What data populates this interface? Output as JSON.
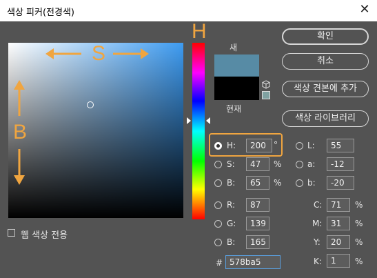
{
  "window": {
    "title": "색상 피커(전경색)",
    "close_icon": "✕"
  },
  "overlay": {
    "s_letter": "S",
    "b_letter": "B",
    "h_letter": "H",
    "accent": "#f0a540"
  },
  "swatches": {
    "new_label": "새",
    "current_label": "현재",
    "new_color": "#578ba5",
    "current_color": "#000000"
  },
  "buttons": {
    "ok": "확인",
    "cancel": "취소",
    "add_to_swatches": "색상 견본에 추가",
    "color_libraries": "색상 라이브러리"
  },
  "hsb": {
    "h": {
      "label": "H:",
      "value": "200",
      "unit": "°",
      "selected": true
    },
    "s": {
      "label": "S:",
      "value": "47",
      "unit": "%"
    },
    "b": {
      "label": "B:",
      "value": "65",
      "unit": "%"
    }
  },
  "rgb": {
    "r": {
      "label": "R:",
      "value": "87"
    },
    "g": {
      "label": "G:",
      "value": "139"
    },
    "b": {
      "label": "B:",
      "value": "165"
    }
  },
  "lab": {
    "l": {
      "label": "L:",
      "value": "55"
    },
    "a": {
      "label": "a:",
      "value": "-12"
    },
    "b": {
      "label": "b:",
      "value": "-20"
    }
  },
  "cmyk": {
    "c": {
      "label": "C:",
      "value": "71",
      "unit": "%"
    },
    "m": {
      "label": "M:",
      "value": "31",
      "unit": "%"
    },
    "y": {
      "label": "Y:",
      "value": "20",
      "unit": "%"
    },
    "k": {
      "label": "K:",
      "value": "1",
      "unit": "%"
    }
  },
  "hex": {
    "label": "#",
    "value": "578ba5"
  },
  "web_only": {
    "label": "웹 색상 전용",
    "checked": false
  }
}
